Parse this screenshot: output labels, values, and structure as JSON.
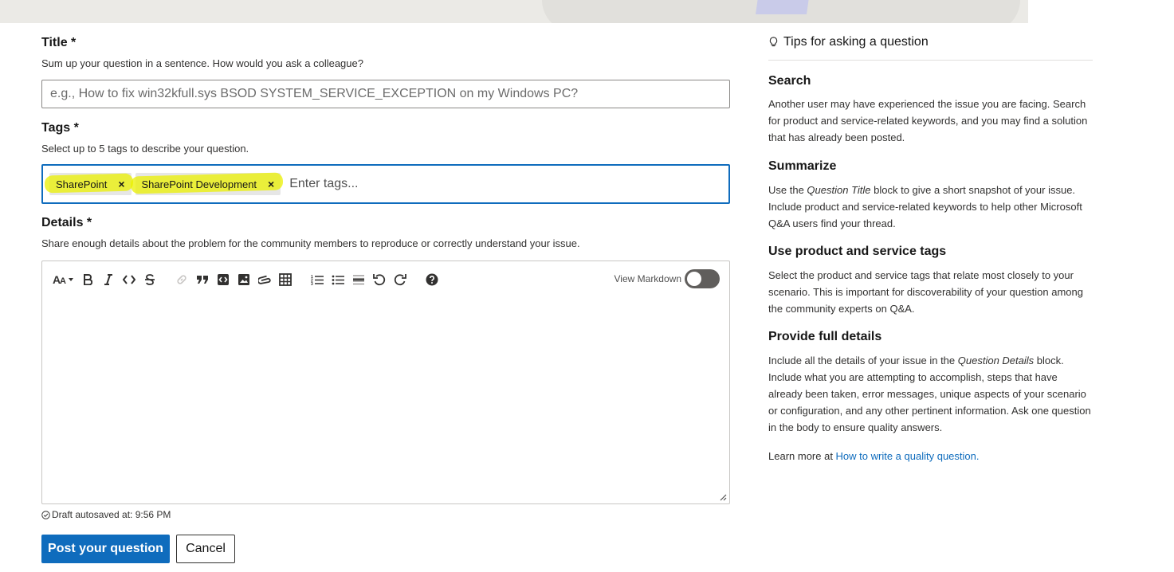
{
  "form": {
    "title_label": "Title *",
    "title_helper": "Sum up your question in a sentence. How would you ask a colleague?",
    "title_placeholder": "e.g., How to fix win32kfull.sys BSOD SYSTEM_SERVICE_EXCEPTION on my Windows PC?",
    "tags_label": "Tags *",
    "tags_helper": "Select up to 5 tags to describe your question.",
    "tags": [
      {
        "label": "SharePoint",
        "remove": "×"
      },
      {
        "label": "SharePoint Development",
        "remove": "×"
      }
    ],
    "tags_placeholder": "Enter tags...",
    "details_label": "Details *",
    "details_helper": "Share enough details about the problem for the community members to reproduce or correctly understand your issue.",
    "editor": {
      "view_markdown_label": "View Markdown",
      "view_markdown_on": false,
      "toolbar_icons": [
        "font-size-icon",
        "bold-icon",
        "italic-icon",
        "code-icon",
        "strikethrough-icon",
        "link-icon",
        "quote-icon",
        "code-block-icon",
        "image-icon",
        "attachment-icon",
        "table-icon",
        "numbered-list-icon",
        "bulleted-list-icon",
        "horizontal-rule-icon",
        "undo-icon",
        "redo-icon",
        "help-icon"
      ]
    },
    "autosave_text": "Draft autosaved at: 9:56 PM",
    "post_button": "Post your question",
    "cancel_button": "Cancel"
  },
  "tips": {
    "header": "Tips for asking a question",
    "search_title": "Search",
    "search_text": "Another user may have experienced the issue you are facing. Search for product and service-related keywords, and you may find a solution that has already been posted.",
    "summarize_title": "Summarize",
    "summarize_pre": "Use the ",
    "summarize_em": "Question Title",
    "summarize_post": " block to give a short snapshot of your issue. Include product and service-related keywords to help other Microsoft Q&A users find your thread.",
    "tags_title": "Use product and service tags",
    "tags_text": "Select the product and service tags that relate most closely to your scenario. This is important for discoverability of your question among the community experts on Q&A.",
    "details_title": "Provide full details",
    "details_pre": "Include all the details of your issue in the ",
    "details_em": "Question Details",
    "details_post": " block. Include what you are attempting to accomplish, steps that have already been taken, error messages, unique aspects of your scenario or configuration, and any other pertinent information. Ask one question in the body to ensure quality answers.",
    "learn_more_pre": "Learn more at ",
    "learn_more_link": "How to write a quality question."
  },
  "colors": {
    "accent": "#0f6cbd",
    "highlight": "#ebf000"
  }
}
